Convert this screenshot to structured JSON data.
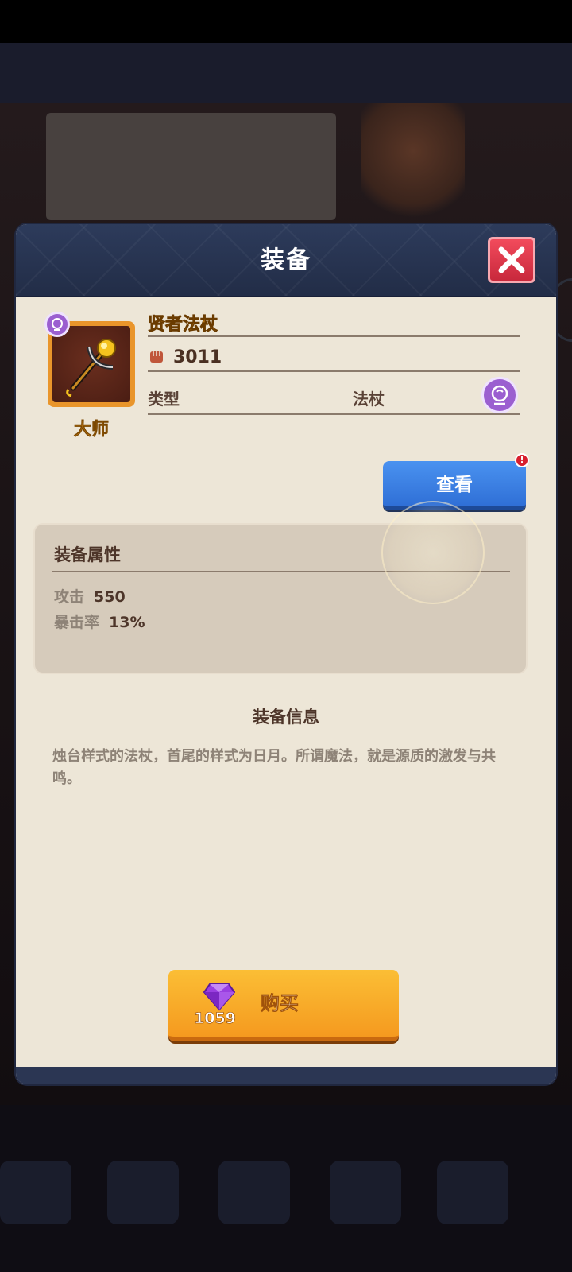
{
  "modal": {
    "title": "装备",
    "close_icon": "close-x-icon"
  },
  "item": {
    "name": "贤者法杖",
    "power": "3011",
    "power_icon": "fist-icon",
    "grade": "大师",
    "type_label": "类型",
    "type_value": "法杖",
    "class_icon": "mage-head-icon",
    "image": "golden-staff-icon"
  },
  "view_button": {
    "label": "查看",
    "notification": "!"
  },
  "attributes": {
    "title": "装备属性",
    "rows": [
      {
        "key": "攻击",
        "value": "550"
      },
      {
        "key": "暴击率",
        "value": "13%"
      }
    ]
  },
  "info": {
    "title": "装备信息",
    "description": "烛台样式的法杖，首尾的样式为日月。所谓魔法，就是源质的激发与共鸣。"
  },
  "buy_button": {
    "label": "购买",
    "price": "1059",
    "currency_icon": "purple-gem-icon"
  },
  "colors": {
    "header_bg": "#2d3b5b",
    "panel_bg": "#ede6d7",
    "close_red": "#e03a4d",
    "view_blue": "#3b7fe3",
    "buy_orange": "#f7ab28",
    "name_gold": "#f6a628",
    "class_purple": "#9b5fd0"
  }
}
